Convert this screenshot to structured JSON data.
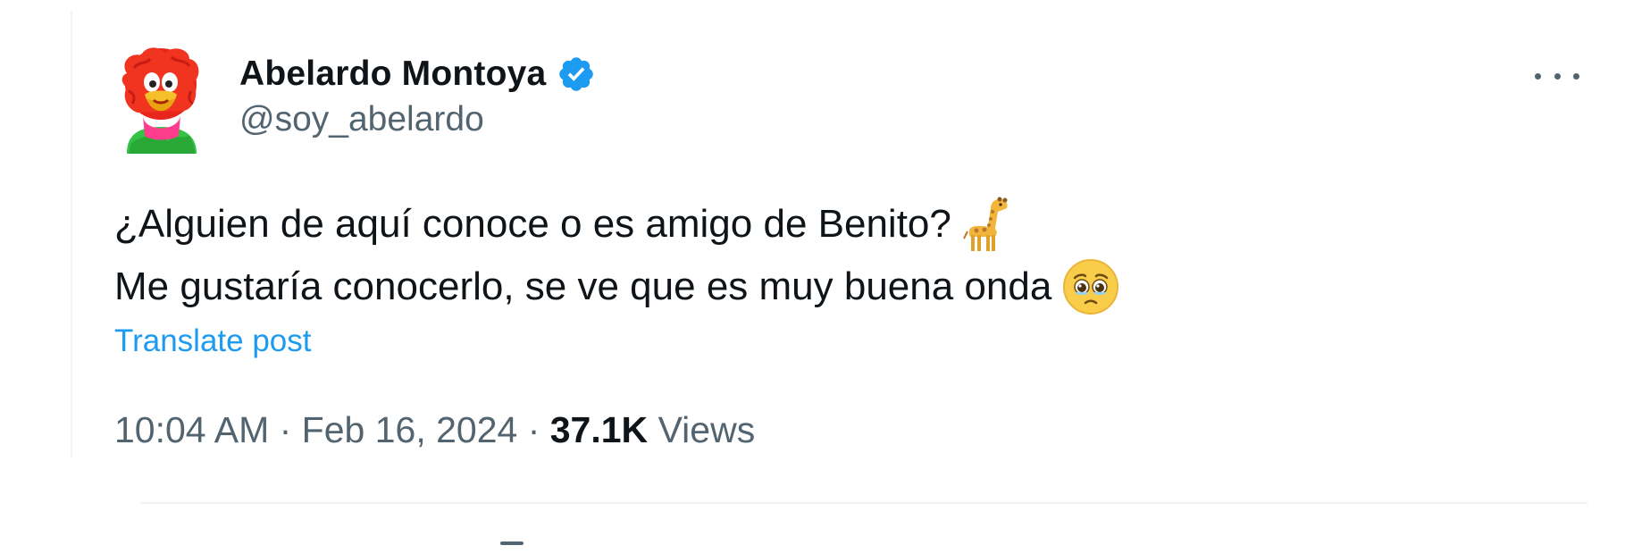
{
  "tweet": {
    "author": {
      "display_name": "Abelardo Montoya",
      "handle": "@soy_abelardo",
      "verified": true
    },
    "text_lines": [
      "¿Alguien de aquí conoce o es amigo de Benito?",
      "Me gustaría conocerlo, se ve que es muy buena onda"
    ],
    "emojis": [
      "giraffe-emoji",
      "face-holding-back-tears-emoji"
    ],
    "translate_label": "Translate post",
    "time": "10:04 AM",
    "separator": " · ",
    "date": "Feb 16, 2024",
    "views_count": "37.1K",
    "views_label": "Views"
  },
  "colors": {
    "text_primary": "#0f1419",
    "text_secondary": "#536471",
    "link_blue": "#1d9bf0",
    "divider": "#eff3f4"
  }
}
